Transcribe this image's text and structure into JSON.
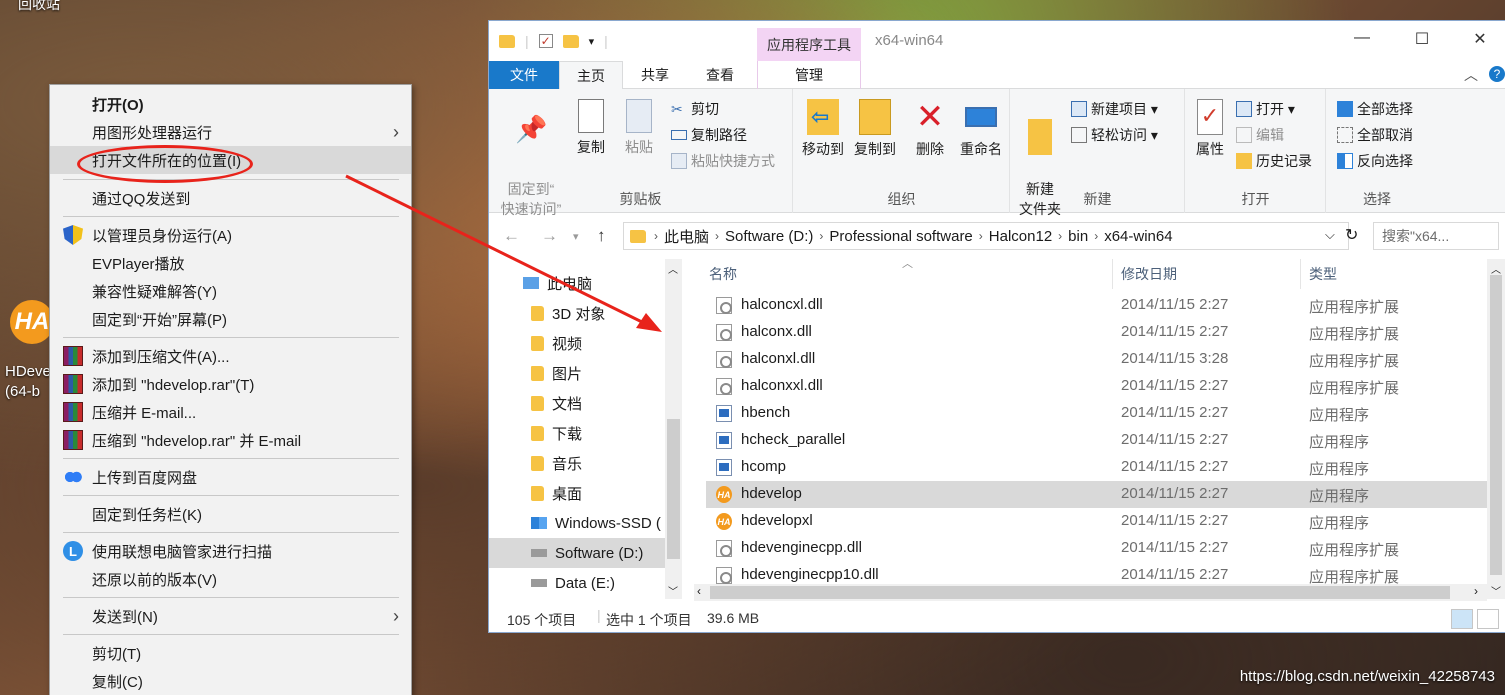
{
  "desktop": {
    "recycle_bin_label": "回收站",
    "app_icon_text": "HA",
    "app_label_line1": "HDeve",
    "app_label_line2": "(64-b"
  },
  "context_menu": {
    "items": [
      {
        "label": "打开(O)",
        "bold": true
      },
      {
        "label": "用图形处理器运行",
        "submenu": true
      },
      {
        "label": "打开文件所在的位置(I)",
        "highlighted": true
      },
      {
        "label": "通过QQ发送到"
      },
      {
        "label": "以管理员身份运行(A)",
        "icon": "uac-shield-icon"
      },
      {
        "label": "EVPlayer播放"
      },
      {
        "label": "兼容性疑难解答(Y)"
      },
      {
        "label": "固定到“开始”屏幕(P)"
      },
      {
        "label": "添加到压缩文件(A)...",
        "icon": "winrar-icon"
      },
      {
        "label": "添加到 \"hdevelop.rar\"(T)",
        "icon": "winrar-icon"
      },
      {
        "label": "压缩并 E-mail...",
        "icon": "winrar-icon"
      },
      {
        "label": "压缩到 \"hdevelop.rar\" 并 E-mail",
        "icon": "winrar-icon"
      },
      {
        "label": "上传到百度网盘",
        "icon": "baidu-netdisk-icon"
      },
      {
        "label": "固定到任务栏(K)"
      },
      {
        "label": "使用联想电脑管家进行扫描",
        "icon": "lenovo-icon"
      },
      {
        "label": "还原以前的版本(V)"
      },
      {
        "label": "发送到(N)",
        "submenu": true
      },
      {
        "label": "剪切(T)"
      },
      {
        "label": "复制(C)"
      }
    ]
  },
  "explorer": {
    "title": "x64-win64",
    "contextual_tab_group": "应用程序工具",
    "tabs": [
      "文件",
      "主页",
      "共享",
      "查看",
      "管理"
    ],
    "ribbon": {
      "clipboard": {
        "pin_quick_access": "固定到“\n快速访问”",
        "copy": "复制",
        "paste": "粘贴",
        "cut": "剪切",
        "copy_path": "复制路径",
        "paste_shortcut": "粘贴快捷方式",
        "group_label": "剪贴板"
      },
      "organize": {
        "move_to": "移动到",
        "copy_to": "复制到",
        "delete": "删除",
        "rename": "重命名",
        "group_label": "组织"
      },
      "new": {
        "new_folder": "新建\n文件夹",
        "new_item": "新建项目 ▾",
        "easy_access": "轻松访问 ▾",
        "group_label": "新建"
      },
      "open": {
        "properties": "属性",
        "open": "打开 ▾",
        "edit": "编辑",
        "history": "历史记录",
        "group_label": "打开"
      },
      "select": {
        "select_all": "全部选择",
        "select_none": "全部取消",
        "invert": "反向选择",
        "group_label": "选择"
      }
    },
    "address": [
      "此电脑",
      "Software (D:)",
      "Professional software",
      "Halcon12",
      "bin",
      "x64-win64"
    ],
    "search_placeholder": "搜索\"x64...",
    "nav_items": [
      {
        "label": "此电脑",
        "icon": "this-pc-icon"
      },
      {
        "label": "3D 对象",
        "icon": "folder-icon"
      },
      {
        "label": "视频",
        "icon": "folder-icon"
      },
      {
        "label": "图片",
        "icon": "folder-icon"
      },
      {
        "label": "文档",
        "icon": "folder-icon"
      },
      {
        "label": "下载",
        "icon": "folder-icon"
      },
      {
        "label": "音乐",
        "icon": "folder-icon"
      },
      {
        "label": "桌面",
        "icon": "folder-icon"
      },
      {
        "label": "Windows-SSD (",
        "icon": "drive-icon"
      },
      {
        "label": "Software (D:)",
        "icon": "drive-icon",
        "selected": true
      },
      {
        "label": "Data (E:)",
        "icon": "drive-icon"
      }
    ],
    "columns": {
      "name": "名称",
      "date": "修改日期",
      "type": "类型"
    },
    "files": [
      {
        "name": "halconcxl.dll",
        "date": "2014/11/15 2:27",
        "type": "应用程序扩展",
        "icon": "dll"
      },
      {
        "name": "halconx.dll",
        "date": "2014/11/15 2:27",
        "type": "应用程序扩展",
        "icon": "dll"
      },
      {
        "name": "halconxl.dll",
        "date": "2014/11/15 3:28",
        "type": "应用程序扩展",
        "icon": "dll"
      },
      {
        "name": "halconxxl.dll",
        "date": "2014/11/15 2:27",
        "type": "应用程序扩展",
        "icon": "dll"
      },
      {
        "name": "hbench",
        "date": "2014/11/15 2:27",
        "type": "应用程序",
        "icon": "exe"
      },
      {
        "name": "hcheck_parallel",
        "date": "2014/11/15 2:27",
        "type": "应用程序",
        "icon": "exe"
      },
      {
        "name": "hcomp",
        "date": "2014/11/15 2:27",
        "type": "应用程序",
        "icon": "exe"
      },
      {
        "name": "hdevelop",
        "date": "2014/11/15 2:27",
        "type": "应用程序",
        "icon": "ha",
        "selected": true
      },
      {
        "name": "hdevelopxl",
        "date": "2014/11/15 2:27",
        "type": "应用程序",
        "icon": "ha"
      },
      {
        "name": "hdevenginecpp.dll",
        "date": "2014/11/15 2:27",
        "type": "应用程序扩展",
        "icon": "dll"
      },
      {
        "name": "hdevenginecpp10.dll",
        "date": "2014/11/15 2:27",
        "type": "应用程序扩展",
        "icon": "dll"
      }
    ],
    "status": {
      "count": "105 个项目",
      "selected": "选中 1 个项目",
      "size": "39.6 MB"
    }
  },
  "watermark": "https://blog.csdn.net/weixin_42258743",
  "colors": {
    "annotation": "#e8231b",
    "file_tab": "#1979ca",
    "contextual": "#f3d4f4"
  }
}
